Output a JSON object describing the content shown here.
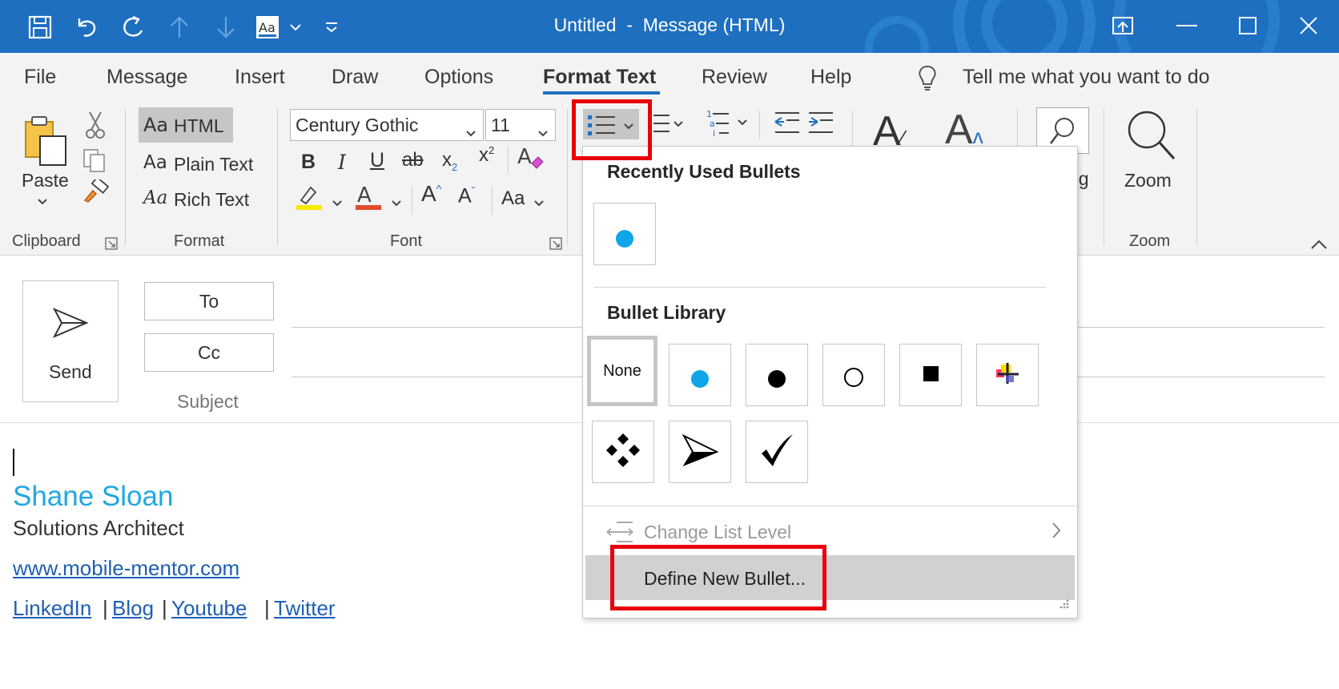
{
  "window": {
    "title": "Untitled  -  Message (HTML)"
  },
  "menu": {
    "tabs": [
      "File",
      "Message",
      "Insert",
      "Draw",
      "Options",
      "Format Text",
      "Review",
      "Help"
    ],
    "active_tab": "Format Text",
    "tell_me": "Tell me what you want to do"
  },
  "ribbon": {
    "clipboard": {
      "paste": "Paste",
      "label": "Clipboard"
    },
    "format": {
      "html": "HTML",
      "plain": "Plain Text",
      "rich": "Rich Text",
      "label": "Format"
    },
    "font": {
      "name": "Century Gothic",
      "size": "11",
      "label": "Font"
    },
    "editing_partial": "ng",
    "zoom": {
      "button": "Zoom",
      "label": "Zoom"
    }
  },
  "compose": {
    "send": "Send",
    "to": "To",
    "cc": "Cc",
    "subject": "Subject"
  },
  "signature": {
    "name": "Shane Sloan",
    "title": "Solutions Architect",
    "website": "www.mobile-mentor.com",
    "links": [
      "LinkedIn",
      "Blog",
      "Youtube",
      "Twitter"
    ],
    "name_color": "#1fa8e0"
  },
  "bullets_menu": {
    "recent_heading": "Recently Used Bullets",
    "library_heading": "Bullet Library",
    "none_label": "None",
    "change_level": "Change List Level",
    "define_new": "Define New Bullet...",
    "accent": "#0ea5e9",
    "library_icons": [
      "none",
      "cyan-dot-icon",
      "black-dot-icon",
      "hollow-circle-icon",
      "square-icon",
      "crosshair-icon",
      "diamond-cluster-icon",
      "arrowhead-icon",
      "checkmark-icon"
    ]
  },
  "colors": {
    "titlebar": "#1e6fc0",
    "highlight_box": "#e8000b"
  }
}
